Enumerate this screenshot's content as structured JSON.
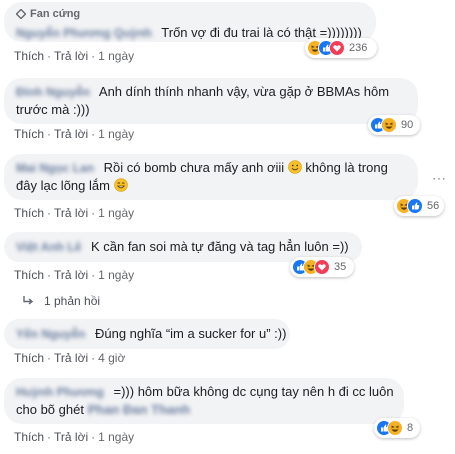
{
  "badge_label": "Fan cứng",
  "comments": [
    {
      "author": "Nguyễn Phương Quỳnh",
      "text": "Trốn vợ đi đu trai là có thật =))))))))",
      "count": "236",
      "like": "Thích",
      "reply": "Trả lời",
      "time": "1 ngày"
    },
    {
      "author": "Đinh Nguyễn",
      "line1": "Anh dính thính nhanh vậy, vừa gặp ở BBMAs hôm",
      "line2": "trước mà :)))",
      "count": "90",
      "like": "Thích",
      "reply": "Trả lời",
      "time": "1 ngày"
    },
    {
      "author": "Mai Ngọc Lan",
      "line1a": "Rồi có bomb chưa mấy anh ơiii",
      "line1b": "không là trong",
      "line2": "đây lạc lõng lắm",
      "count": "56",
      "like": "Thích",
      "reply": "Trả lời",
      "time": "1 ngày"
    },
    {
      "author": "Việt Anh Lê",
      "text": "K cần fan soi mà tự đăng và tag hẳn luôn =))",
      "count": "35",
      "like": "Thích",
      "reply": "Trả lời",
      "time": "1 ngày"
    },
    {
      "author": "Yến Nguyễn",
      "text": "Đúng nghĩa “im a sucker for u” :))",
      "like": "Thích",
      "reply": "Trả lời",
      "time": "4 giờ"
    },
    {
      "author": "Huỳnh Phương",
      "line1": "=))) hôm bữa không dc cụng tay nên h đi cc luôn",
      "line2a": "cho bõ ghét",
      "tag": "Phan Đan Thanh",
      "count": "8",
      "like": "Thích",
      "reply": "Trả lời",
      "time": "1 ngày"
    }
  ],
  "replies_label": "1 phản hồi",
  "colors": {
    "bubble_bg": "#f2f3f5",
    "name": "#385898",
    "like_blue": "#1877f2",
    "haha_yellow": "#f7b125",
    "love_red": "#f33e58"
  },
  "icons": [
    "like-icon",
    "haha-icon",
    "love-icon",
    "smile-emoji",
    "grin-emoji",
    "reply-arrow-icon",
    "more-options-icon",
    "fan-badge-icon"
  ]
}
